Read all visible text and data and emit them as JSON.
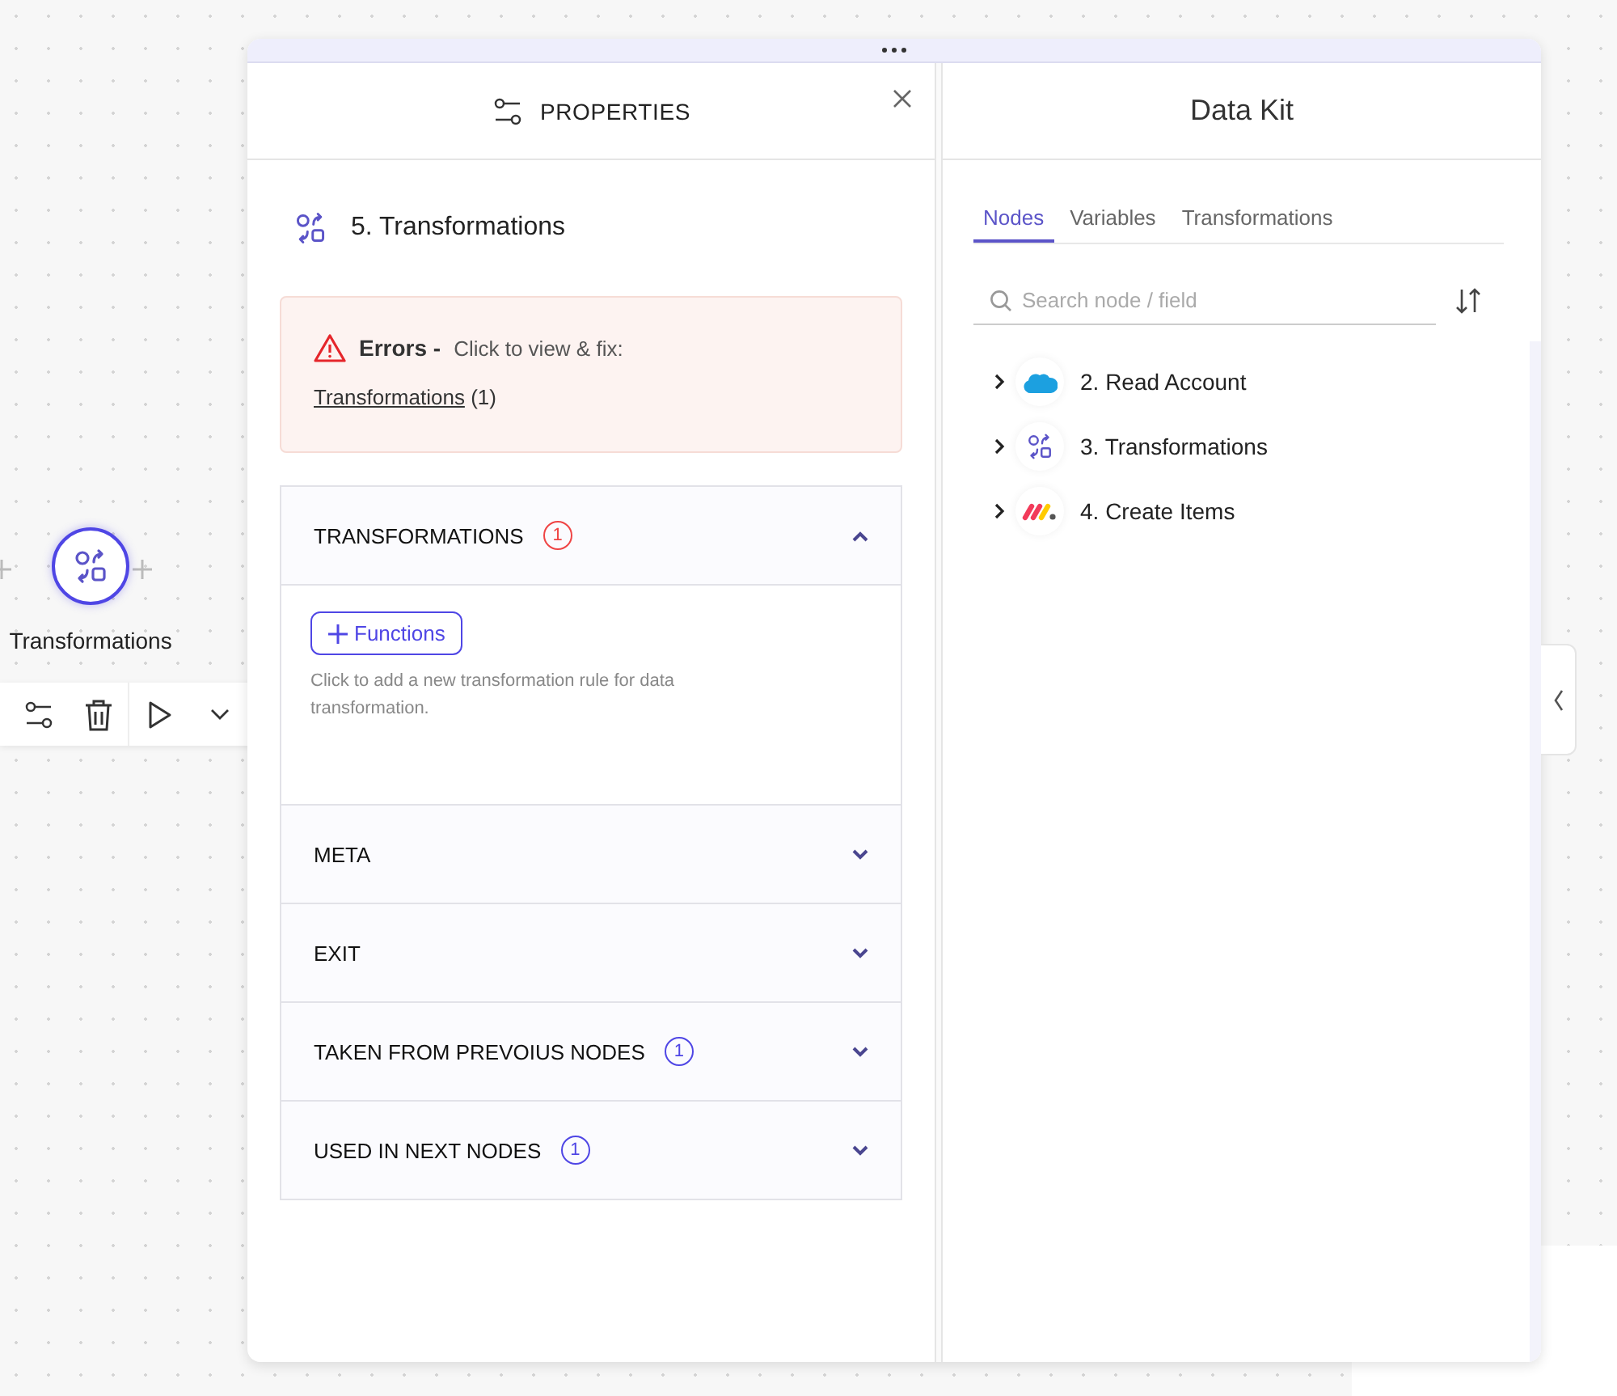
{
  "canvas": {
    "node": {
      "label": "Transformations"
    }
  },
  "properties": {
    "header": "PROPERTIES",
    "title": "5. Transformations",
    "errors": {
      "heading": "Errors -",
      "hint": "Click to view & fix:",
      "link": "Transformations",
      "count": "(1)"
    },
    "sections": [
      {
        "title": "TRANSFORMATIONS",
        "badge": {
          "text": "1",
          "color": "#ef4444"
        },
        "expanded": true,
        "button": "Functions",
        "help": "Click to add a new transformation rule for data transformation."
      },
      {
        "title": "META",
        "expanded": false
      },
      {
        "title": "EXIT",
        "expanded": false
      },
      {
        "title": "TAKEN FROM PREVOIUS NODES",
        "badge": {
          "text": "1",
          "color": "#4f46e5"
        },
        "expanded": false
      },
      {
        "title": "USED IN NEXT NODES",
        "badge": {
          "text": "1",
          "color": "#4f46e5"
        },
        "expanded": false
      }
    ]
  },
  "data_kit": {
    "title": "Data Kit",
    "tabs": [
      {
        "label": "Nodes",
        "selected": true
      },
      {
        "label": "Variables",
        "selected": false
      },
      {
        "label": "Transformations",
        "selected": false
      }
    ],
    "search": {
      "placeholder": "Search node / field"
    },
    "nodes": [
      {
        "label": "2. Read Account",
        "kind": "cloud",
        "expanded": false
      },
      {
        "label": "3. Transformations",
        "kind": "transform",
        "expanded": false
      },
      {
        "label": "4. Create Items",
        "kind": "board",
        "expanded": false
      }
    ]
  }
}
